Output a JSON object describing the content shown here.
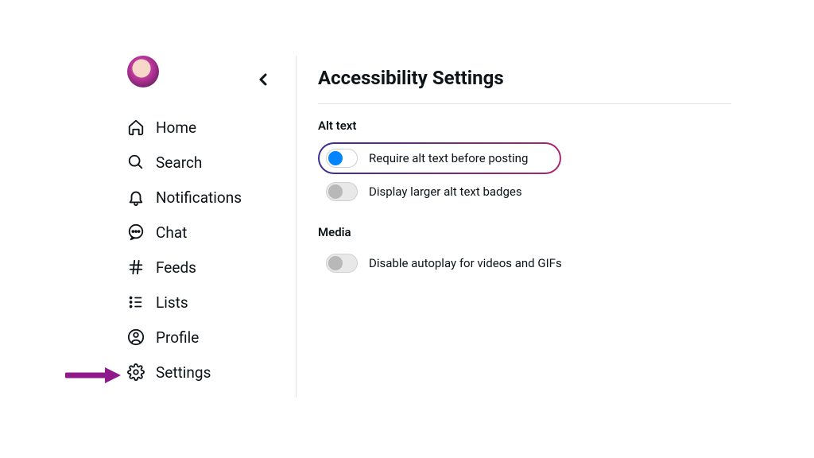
{
  "sidebar": {
    "items": [
      {
        "label": "Home",
        "icon": "home-icon"
      },
      {
        "label": "Search",
        "icon": "search-icon"
      },
      {
        "label": "Notifications",
        "icon": "bell-icon"
      },
      {
        "label": "Chat",
        "icon": "chat-icon"
      },
      {
        "label": "Feeds",
        "icon": "hash-icon"
      },
      {
        "label": "Lists",
        "icon": "lists-icon"
      },
      {
        "label": "Profile",
        "icon": "profile-icon"
      },
      {
        "label": "Settings",
        "icon": "gear-icon"
      }
    ]
  },
  "page": {
    "title": "Accessibility Settings"
  },
  "sections": {
    "alt_text": {
      "title": "Alt text",
      "require_label": "Require alt text before posting",
      "require_on": true,
      "larger_badges_label": "Display larger alt text badges",
      "larger_badges_on": false
    },
    "media": {
      "title": "Media",
      "disable_autoplay_label": "Disable autoplay for videos and GIFs",
      "disable_autoplay_on": false
    }
  },
  "colors": {
    "accent_blue": "#0085ff",
    "highlight_gradient_start": "#3a2f8f",
    "highlight_gradient_end": "#a8276e",
    "arrow": "#8e1a8c"
  }
}
